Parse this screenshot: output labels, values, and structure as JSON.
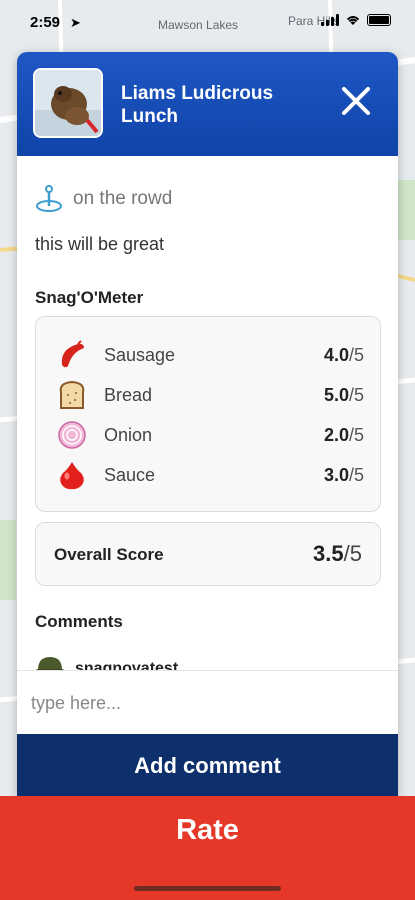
{
  "status_bar": {
    "time": "2:59"
  },
  "map": {
    "labels": [
      "Mawson Lakes",
      "Para Hills"
    ]
  },
  "card": {
    "title": "Liams Ludicrous Lunch",
    "location": "on the rowd",
    "description": "this will be great",
    "meter_title": "Snag'O'Meter",
    "ratings": [
      {
        "name": "Sausage",
        "score": "4.0",
        "out_of": "/5",
        "icon": "sausage-icon"
      },
      {
        "name": "Bread",
        "score": "5.0",
        "out_of": "/5",
        "icon": "bread-icon"
      },
      {
        "name": "Onion",
        "score": "2.0",
        "out_of": "/5",
        "icon": "onion-icon"
      },
      {
        "name": "Sauce",
        "score": "3.0",
        "out_of": "/5",
        "icon": "sauce-icon"
      }
    ],
    "overall": {
      "label": "Overall Score",
      "score": "3.5",
      "out_of": "/5"
    },
    "comments_title": "Comments",
    "comments": [
      {
        "user": "snagnovatest"
      }
    ],
    "input_placeholder": "type here...",
    "add_comment_label": "Add comment"
  },
  "rate_label": "Rate",
  "colors": {
    "header_blue": "#1f57c4",
    "button_navy": "#0d2f6b",
    "rate_red": "#e63829"
  }
}
